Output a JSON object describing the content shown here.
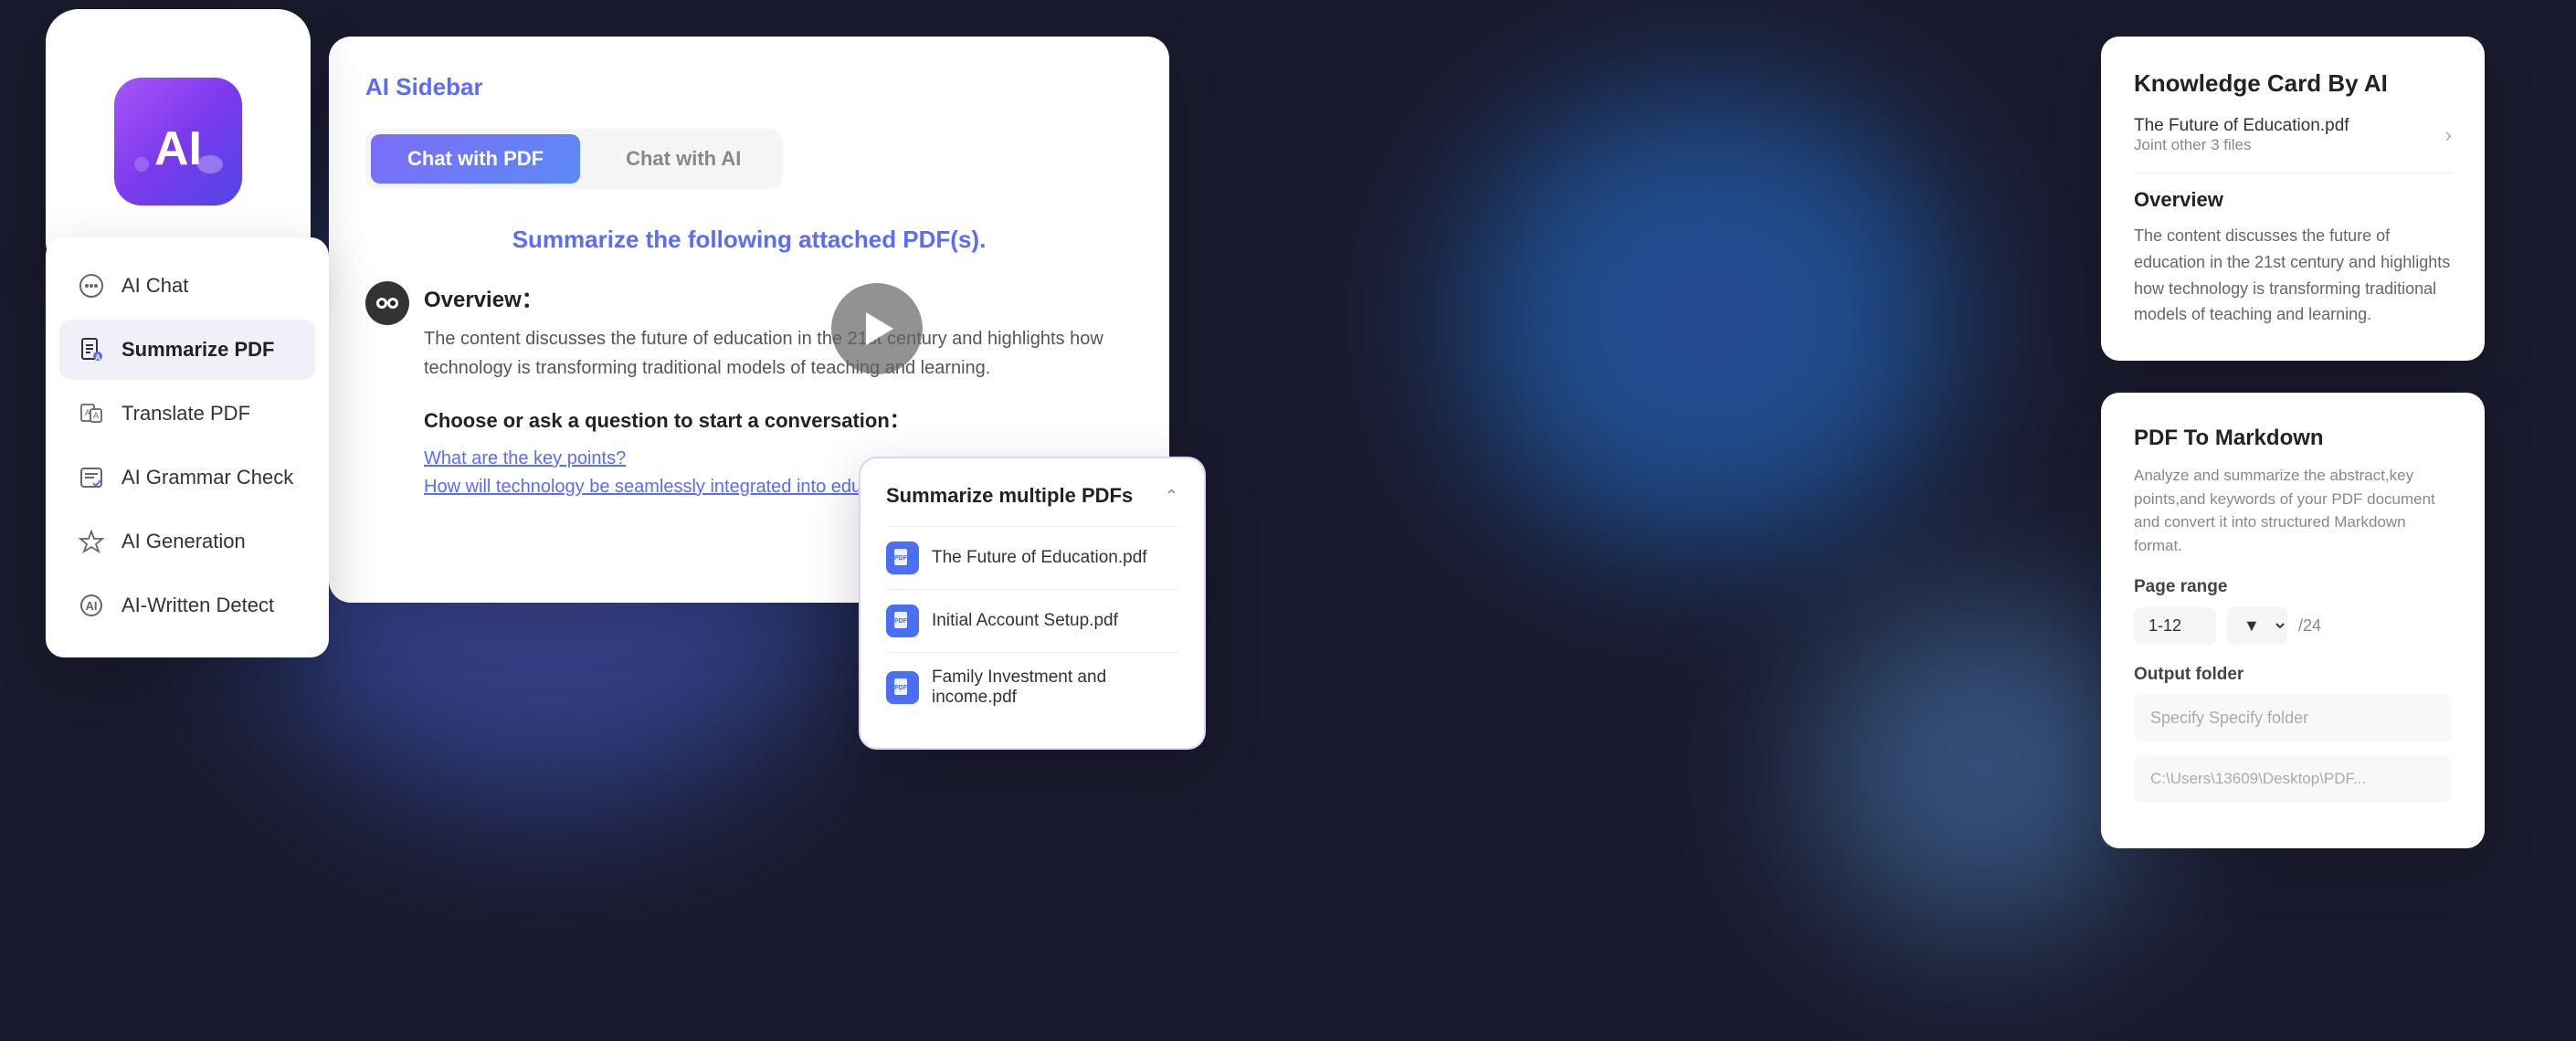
{
  "background": {
    "color": "#1a1a2e"
  },
  "logo_card": {
    "alt": "AI Logo"
  },
  "sidebar_menu": {
    "items": [
      {
        "id": "ai-chat",
        "label": "AI Chat",
        "active": false
      },
      {
        "id": "summarize-pdf",
        "label": "Summarize PDF",
        "active": true
      },
      {
        "id": "translate-pdf",
        "label": "Translate PDF",
        "active": false
      },
      {
        "id": "ai-grammar-check",
        "label": "AI Grammar Check",
        "active": false
      },
      {
        "id": "ai-generation",
        "label": "AI Generation",
        "active": false
      },
      {
        "id": "ai-written-detect",
        "label": "AI-Written Detect",
        "active": false
      }
    ]
  },
  "ai_sidebar_panel": {
    "title": "AI Sidebar",
    "tabs": [
      {
        "id": "chat-pdf",
        "label": "Chat with PDF",
        "active": true
      },
      {
        "id": "chat-ai",
        "label": "Chat with AI",
        "active": false
      }
    ],
    "chat_prompt": "Summarize the following attached PDF(s).",
    "overview": {
      "title": "Overview：",
      "text": "The content discusses the future of education in the 21st century and highlights how technology is transforming traditional models of teaching and learning."
    },
    "questions_title": "Choose or ask a question to start a conversation：",
    "questions": [
      {
        "id": "q1",
        "text": "What are the key points?"
      },
      {
        "id": "q2",
        "text": "How will technology be seamlessly integrated into education?"
      }
    ]
  },
  "summarize_pdfs_card": {
    "title": "Summarize multiple PDFs",
    "files": [
      {
        "id": "f1",
        "name": "The Future of Education.pdf"
      },
      {
        "id": "f2",
        "name": "Initial Account Setup.pdf"
      },
      {
        "id": "f3",
        "name": "Family Investment and income.pdf"
      }
    ]
  },
  "knowledge_card": {
    "title": "Knowledge Card By AI",
    "filename": "The Future of Education.pdf",
    "joint_text": "Joint other 3 files",
    "overview_heading": "Overview",
    "overview_text": "The content discusses the future of education in the 21st century and highlights how technology is transforming traditional models of teaching and learning."
  },
  "pdf_markdown_card": {
    "title": "PDF To Markdown",
    "description": "Analyze and summarize the abstract,key points,and keywords of your PDF document and convert it into structured Markdown format.",
    "page_range_label": "Page range",
    "page_range_value": "1-12",
    "page_total": "/24",
    "output_folder_label": "Output folder",
    "output_folder_placeholder": "Specify Specify folder",
    "output_folder_path": "C:\\Users\\13609\\Desktop\\PDF..."
  }
}
